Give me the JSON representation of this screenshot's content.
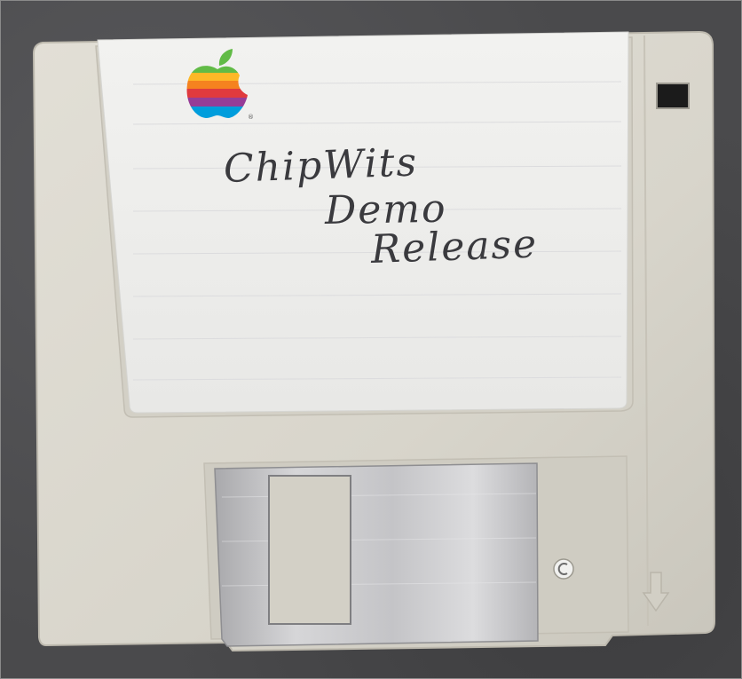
{
  "label": {
    "handwriting_lines": [
      "ChipWits",
      "Demo",
      "Release"
    ]
  },
  "logo": {
    "name": "apple-rainbow-logo",
    "stripe_colors": [
      "#61bb46",
      "#fdb827",
      "#f5821f",
      "#e03a3e",
      "#963d97",
      "#009ddc"
    ]
  },
  "colors": {
    "disk_body": "#d9d6cc",
    "label_paper": "#eeeeec",
    "shutter_metal": "#c9c9cb",
    "background": "#4a4a4c"
  }
}
